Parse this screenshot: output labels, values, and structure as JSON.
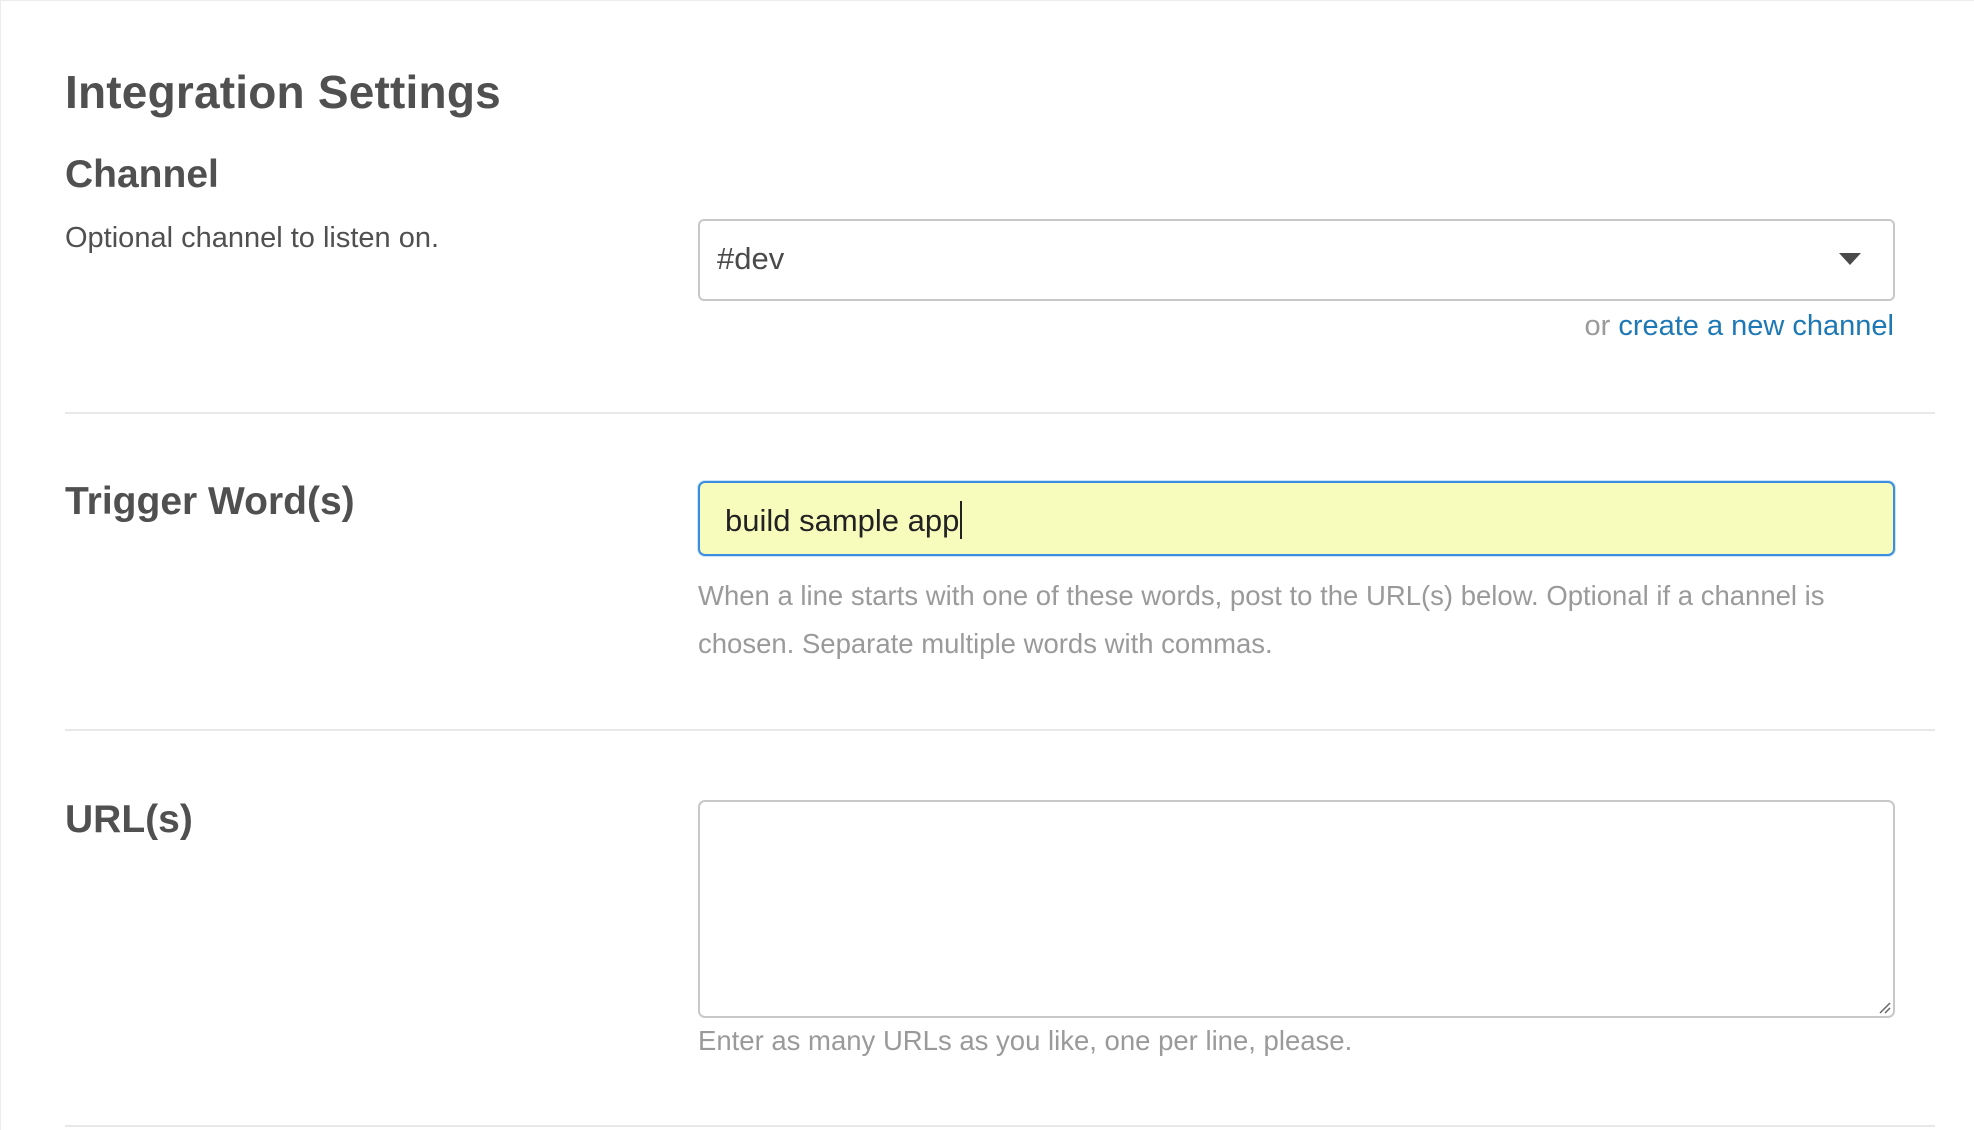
{
  "page": {
    "title": "Integration Settings"
  },
  "channel": {
    "label": "Channel",
    "description": "Optional channel to listen on.",
    "selected_value": "#dev",
    "create_prefix": "or",
    "create_link_label": "create a new channel"
  },
  "trigger": {
    "label": "Trigger Word(s)",
    "value": "build sample app",
    "help": "When a line starts with one of these words, post to the URL(s) below. Optional if a channel is chosen. Separate multiple words with commas."
  },
  "urls": {
    "label": "URL(s)",
    "value": "",
    "help": "Enter as many URLs as you like, one per line, please."
  },
  "icons": {
    "select_caret": "caret-down-icon",
    "textarea_resize": "resize-handle-icon"
  },
  "colors": {
    "link": "#1d78b5",
    "focus_border": "#3a8ee0",
    "autofill_background": "#f7fbbc",
    "help_text": "#9a9a9a",
    "heading": "#505050"
  }
}
